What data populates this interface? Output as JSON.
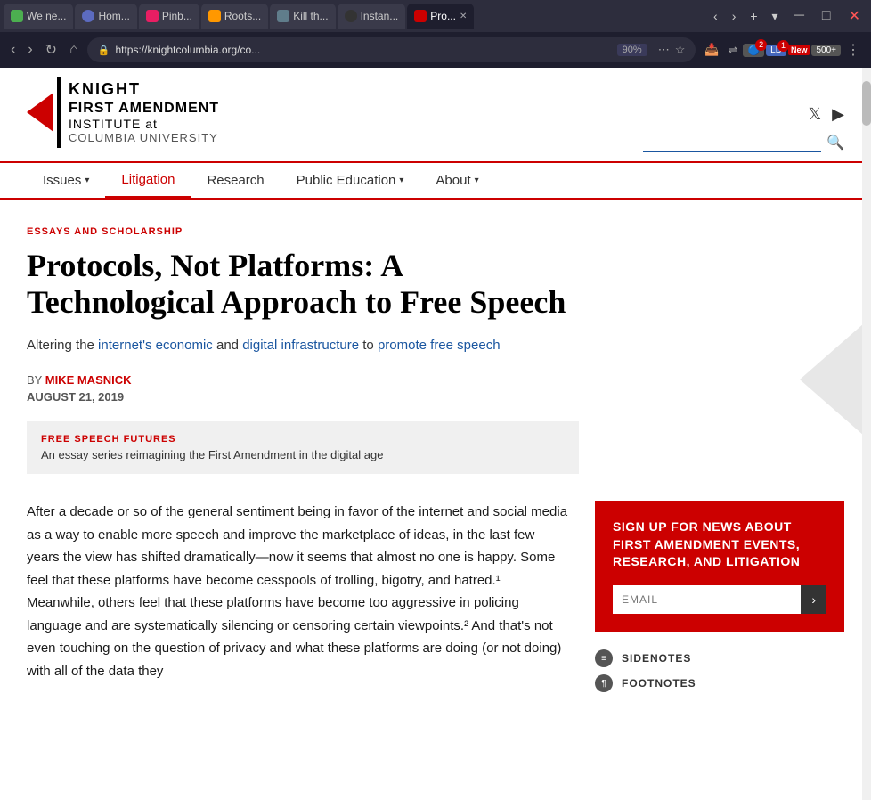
{
  "browser": {
    "tabs": [
      {
        "id": "t1",
        "label": "We ne...",
        "icon_color": "#4CAF50",
        "active": false
      },
      {
        "id": "t2",
        "label": "Hom...",
        "icon_color": "#5c6bc0",
        "active": false
      },
      {
        "id": "t3",
        "label": "Pinb...",
        "icon_color": "#e91e63",
        "active": false
      },
      {
        "id": "t4",
        "label": "Roots...",
        "icon_color": "#ff9800",
        "active": false
      },
      {
        "id": "t5",
        "label": "Kill th...",
        "icon_color": "#607d8b",
        "active": false
      },
      {
        "id": "t6",
        "label": "Instan...",
        "icon_color": "#333",
        "active": false
      },
      {
        "id": "t7",
        "label": "Pro...",
        "icon_color": "#cc0000",
        "active": true
      }
    ],
    "url": "https://knightcolumbia.org/co...",
    "zoom": "90%",
    "new_badge": "New"
  },
  "site": {
    "logo": {
      "line1": "KNIGHT",
      "line2": "FIRST AMENDMENT",
      "line3": "INSTITUTE at",
      "line4": "COLUMBIA UNIVERSITY"
    },
    "nav": {
      "items": [
        {
          "label": "Issues",
          "dropdown": true,
          "active": false
        },
        {
          "label": "Litigation",
          "dropdown": false,
          "active": true
        },
        {
          "label": "Research",
          "dropdown": false,
          "active": false
        },
        {
          "label": "Public Education",
          "dropdown": true,
          "active": false
        },
        {
          "label": "About",
          "dropdown": true,
          "active": false
        }
      ]
    },
    "article": {
      "category": "ESSAYS AND SCHOLARSHIP",
      "title": "Protocols, Not Platforms: A Technological Approach to Free Speech",
      "subtitle": "Altering the internet's economic and digital infrastructure to promote free speech",
      "byline_prefix": "BY",
      "author": "MIKE MASNICK",
      "date": "AUGUST 21, 2019",
      "essay_series_label": "FREE SPEECH FUTURES",
      "essay_series_desc": "An essay series reimagining the First Amendment in the digital age",
      "body_text": "After a decade or so of the general sentiment being in favor of the internet and social media as a way to enable more speech and improve the marketplace of ideas, in the last few years the view has shifted dramatically—now it seems that almost no one is happy. Some feel that these platforms have become cesspools of trolling, bigotry, and hatred.¹ Meanwhile, others feel that these platforms have become too aggressive in policing language and are systematically silencing or censoring certain viewpoints.² And that's not even touching on the question of privacy and what these platforms are doing (or not doing) with all of the data they"
    },
    "sidebar": {
      "signup_title": "SIGN UP FOR NEWS ABOUT FIRST AMENDMENT EVENTS, RESEARCH, AND LITIGATION",
      "email_placeholder": "EMAIL",
      "submit_icon": "›",
      "sidenotes_label": "SIDENOTES",
      "footnotes_label": "FOOTNOTES"
    }
  }
}
